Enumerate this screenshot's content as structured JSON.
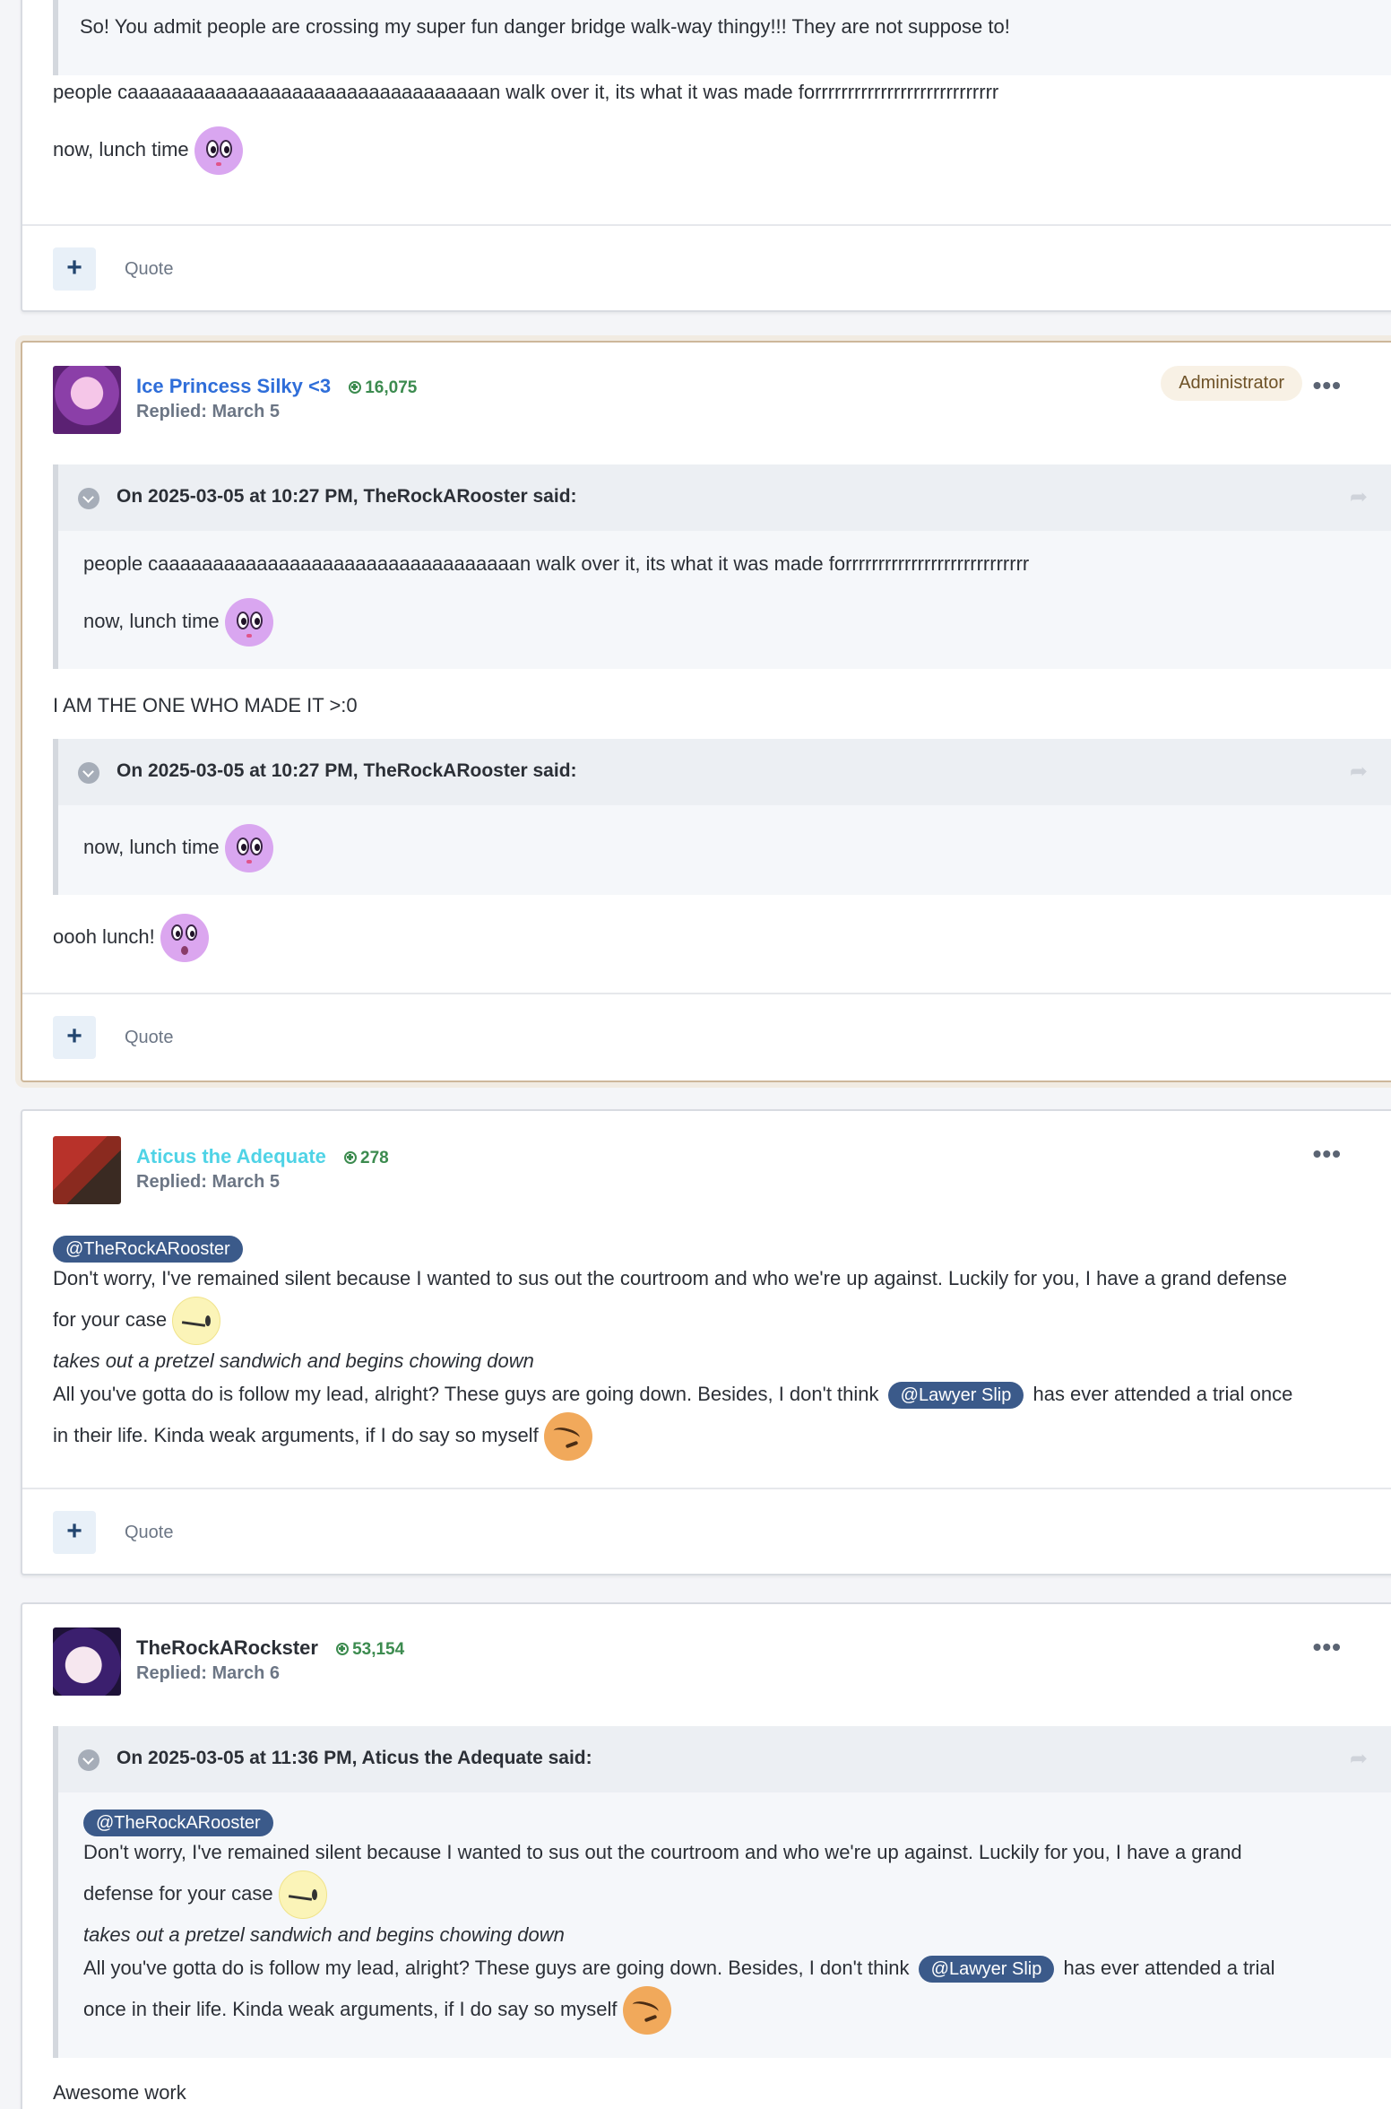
{
  "posts": [
    {
      "body": {
        "quote_text": "So! You admit people are crossing my super fun danger bridge walk-way thingy!!! They are not suppose to!",
        "line1": "people caaaaaaaaaaaaaaaaaaaaaaaaaaaaaaaaan walk over it, its what it was made forrrrrrrrrrrrrrrrrrrrrrrrrrrr",
        "line2": "now, lunch time"
      },
      "footer": {
        "plus": "+",
        "quote": "Quote"
      }
    },
    {
      "author": "Ice Princess Silky <3",
      "author_color": "#2f6ed9",
      "reputation": "16,075",
      "replied": "Replied: March 5",
      "badge": "Administrator",
      "quote1": {
        "title": "On 2025-03-05 at 10:27 PM, TheRockARooster said:",
        "line1": "people caaaaaaaaaaaaaaaaaaaaaaaaaaaaaaaaan walk over it, its what it was made forrrrrrrrrrrrrrrrrrrrrrrrrrrr",
        "line2": "now, lunch time"
      },
      "text1": "I AM THE ONE WHO MADE IT >:0",
      "quote2": {
        "title": "On 2025-03-05 at 10:27 PM, TheRockARooster said:",
        "line1": "now, lunch time"
      },
      "text2": "oooh lunch!",
      "footer": {
        "plus": "+",
        "quote": "Quote"
      }
    },
    {
      "author": "Aticus the Adequate",
      "author_color": "#4fd3e6",
      "reputation": "278",
      "replied": "Replied: March 5",
      "mention1": "@TheRockARooster",
      "line1": "Don't worry, I've remained silent because I wanted to sus out the courtroom and who we're up against. Luckily for you, I have a grand defense",
      "line2": "for your case",
      "line3": "takes out a pretzel sandwich and begins chowing down",
      "line4a": "All you've gotta do is follow my lead, alright? These guys are going down. Besides, I don't think",
      "mention2": "@Lawyer Slip",
      "line4b": "has ever attended a trial once",
      "line5": "in their life. Kinda weak arguments, if I do say so myself",
      "footer": {
        "plus": "+",
        "quote": "Quote"
      }
    },
    {
      "author": "TheRockARockster",
      "author_color": "#2b2f36",
      "reputation": "53,154",
      "replied": "Replied: March 6",
      "quote": {
        "title": "On 2025-03-05 at 11:36 PM, Aticus the Adequate said:",
        "mention1": "@TheRockARooster",
        "line1": "Don't worry, I've remained silent because I wanted to sus out the courtroom and who we're up against. Luckily for you, I have a grand",
        "line2": "defense for your case",
        "line3": "takes out a pretzel sandwich and begins chowing down",
        "line4a": "All you've gotta do is follow my lead, alright? These guys are going down. Besides, I don't think",
        "mention2": "@Lawyer Slip",
        "line4b": "has ever attended a trial",
        "line5": "once in their life. Kinda weak arguments, if I do say so myself"
      },
      "text": "Awesome work"
    }
  ]
}
